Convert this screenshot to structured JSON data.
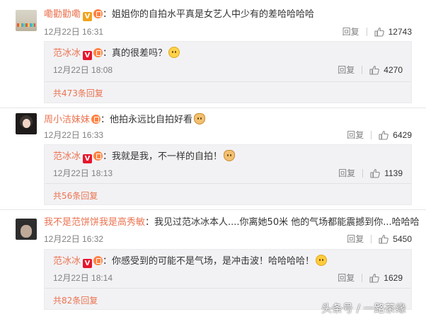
{
  "comments": [
    {
      "user": "嘞勸勸嘞",
      "text": "：姐姐你的自拍水平真是女艺人中少有的差哈哈哈哈",
      "time": "12月22日 16:31",
      "reply_label": "回复",
      "likes": "12743",
      "replies": [
        {
          "user": "范冰冰",
          "text": "：真的很差吗？",
          "time": "12月22日 18:08",
          "reply_label": "回复",
          "likes": "4270"
        }
      ],
      "more_replies": "共473条回复"
    },
    {
      "user": "周小洁妹妹",
      "text": "：他拍永远比自拍好看",
      "time": "12月22日 16:33",
      "reply_label": "回复",
      "likes": "6429",
      "replies": [
        {
          "user": "范冰冰",
          "text": "：我就是我，不一样的自拍！",
          "time": "12月22日 18:13",
          "reply_label": "回复",
          "likes": "1139"
        }
      ],
      "more_replies": "共56条回复"
    },
    {
      "user": "我不是范饼饼我是高秀敏",
      "text": "：我见过范冰冰本人....你离她50米 他的气场都能震撼到你...哈哈哈",
      "time": "12月22日 16:32",
      "reply_label": "回复",
      "likes": "5450",
      "replies": [
        {
          "user": "范冰冰",
          "text": "：你感受到的可能不是气场，是冲击波！哈哈哈哈！",
          "time": "12月22日 18:14",
          "reply_label": "回复",
          "likes": "1629"
        }
      ],
      "more_replies": "共82条回复"
    }
  ],
  "badges": {
    "v_label": "V"
  },
  "watermark": "头条号 / 一路茶缘",
  "colors": {
    "username": "#eb7350",
    "text": "#333333",
    "meta": "#808080",
    "reply_box": "#f2f2f5",
    "v_gold": "#f0a31c",
    "v_red": "#e6162d"
  },
  "icons": [
    "v-badge-icon",
    "gift-badge-icon",
    "like-icon",
    "smiley-emoji-icon",
    "cat-emoji-icon",
    "laugh-emoji-icon"
  ]
}
